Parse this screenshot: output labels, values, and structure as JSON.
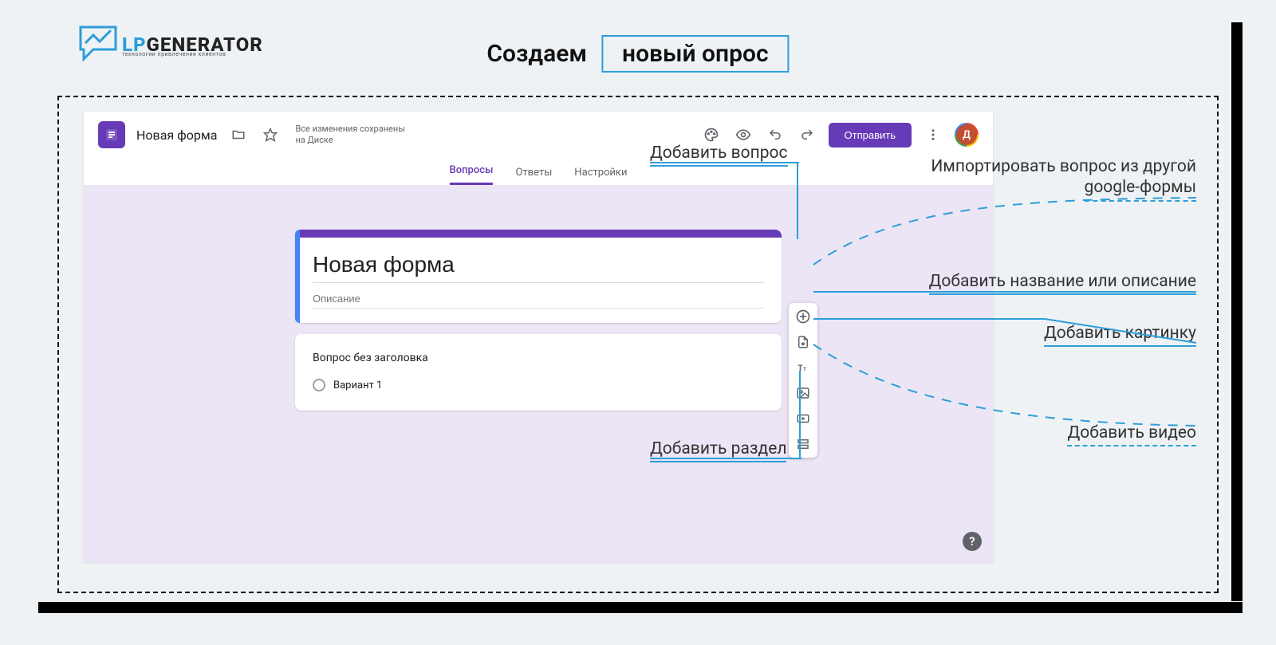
{
  "logo": {
    "brand_prefix": "LP",
    "brand_suffix": "GENERATOR",
    "tagline": "технологии привлечения клиентов"
  },
  "heading": {
    "prefix": "Создаем",
    "boxed": "новый опрос"
  },
  "header": {
    "form_title": "Новая форма",
    "save_status_line1": "Все изменения сохранены",
    "save_status_line2": "на Диске",
    "send_label": "Отправить",
    "avatar_letter": "Д"
  },
  "tabs": {
    "questions": "Вопросы",
    "answers": "Ответы",
    "settings": "Настройки"
  },
  "form": {
    "title_value": "Новая форма",
    "description_placeholder": "Описание"
  },
  "question": {
    "text": "Вопрос без заголовка",
    "option1": "Вариант 1"
  },
  "toolbar": {
    "add_question": "add-question",
    "import_question": "import-question",
    "add_title": "add-title-desc",
    "add_image": "add-image",
    "add_video": "add-video",
    "add_section": "add-section"
  },
  "annotations": {
    "add_question": "Добавить вопрос",
    "import_question_line1": "Импортировать вопрос из другой",
    "import_question_line2": "google-формы",
    "add_title": "Добавить название или описание",
    "add_image": "Добавить картинку",
    "add_video": "Добавить видео",
    "add_section": "Добавить раздел"
  },
  "help_button": "?"
}
